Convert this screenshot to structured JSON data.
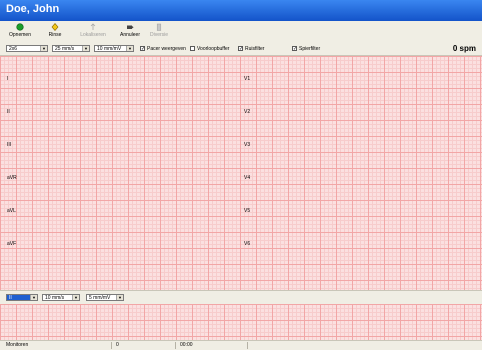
{
  "window": {
    "title": "Doe, John"
  },
  "toolbar": {
    "buttons": [
      {
        "label": "Opnemen",
        "icon": "record-icon",
        "enabled": true
      },
      {
        "label": "Rinse",
        "icon": "rinse-icon",
        "enabled": true
      },
      {
        "label": "Lokaliseren",
        "icon": "locate-icon",
        "enabled": false
      },
      {
        "label": "Annuleer",
        "icon": "cancel-icon",
        "enabled": true
      },
      {
        "label": "Diversie",
        "icon": "trash-icon",
        "enabled": false
      }
    ]
  },
  "options": {
    "lead_set": "2x6",
    "speed": "25 mm/s",
    "gain": "10 mm/mV",
    "pacer_label": "Pacer weergeven",
    "pacer_checked": true,
    "buffer_label": "Voorloopbuffer",
    "buffer_checked": false,
    "hum_label": "Ruisfilter",
    "hum_checked": true,
    "muscle_label": "Spierfilter",
    "muscle_checked": true,
    "bpm": "0 spm"
  },
  "leads": {
    "left": [
      "I",
      "II",
      "III",
      "aVR",
      "aVL",
      "aVF"
    ],
    "right": [
      "V1",
      "V2",
      "V3",
      "V4",
      "V5",
      "V6"
    ]
  },
  "rhythm": {
    "lead": "II",
    "speed": "10 mm/s",
    "gain": "5 mm/mV"
  },
  "status": {
    "mode": "Monitoren",
    "count": "0",
    "time": "00:00"
  }
}
